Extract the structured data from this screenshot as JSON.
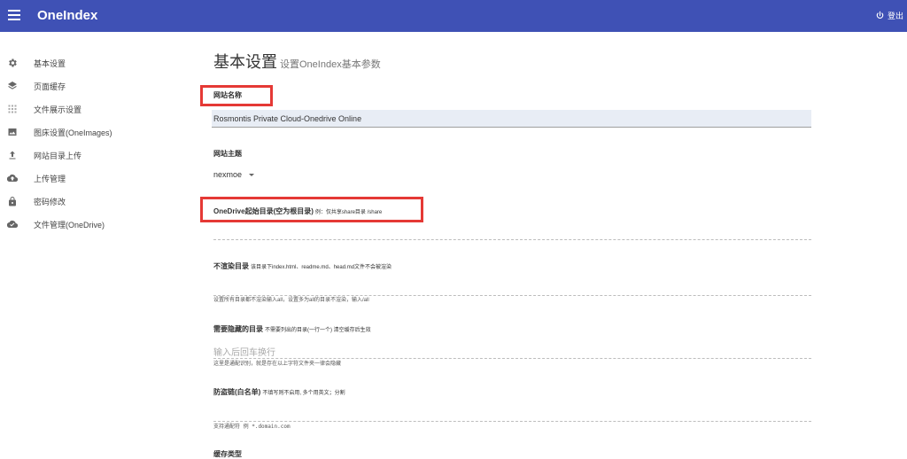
{
  "app": {
    "title": "OneIndex",
    "logout_label": "登出"
  },
  "sidebar": {
    "items": [
      {
        "label": "基本设置",
        "icon": "gear-icon"
      },
      {
        "label": "页面缓存",
        "icon": "layers-icon"
      },
      {
        "label": "文件展示设置",
        "icon": "grid-icon"
      },
      {
        "label": "图床设置(OneImages)",
        "icon": "image-icon"
      },
      {
        "label": "网站目录上传",
        "icon": "upload-icon"
      },
      {
        "label": "上传管理",
        "icon": "cloud-upload-icon"
      },
      {
        "label": "密码修改",
        "icon": "lock-icon"
      },
      {
        "label": "文件管理(OneDrive)",
        "icon": "cloud-done-icon"
      }
    ]
  },
  "page": {
    "title": "基本设置",
    "subtitle": "设置OneIndex基本参数"
  },
  "form": {
    "site_name": {
      "label": "网站名称",
      "value": "Rosmontis Private Cloud-Onedrive Online"
    },
    "theme": {
      "label": "网站主题",
      "value": "nexmoe"
    },
    "root_dir": {
      "label": "OneDrive起始目录(空为根目录)",
      "note": "例：仅共享share目录 /share",
      "value": ""
    },
    "hide_render": {
      "label": "不渲染目录",
      "note": "该目录下index.html、readme.md、head.md文件不会被渲染",
      "hint": "设置所有目录都不渲染输入all，设置多为all的目录不渲染，输入/all",
      "value": ""
    },
    "hidden_dirs": {
      "label": "需要隐藏的目录",
      "note": "不需要列出的目录(一行一个) 清空缓存后生效",
      "placeholder": "输入后回车换行",
      "hint": "这里是通配识别，就是存在以上字符文件夹一律会隐藏"
    },
    "hotlink": {
      "label": "防盗链(白名单)",
      "note": "不填写则不启用, 多个用英文；分割",
      "hint": "支持通配符 例 *.domain.com",
      "value": ""
    },
    "cache_type": {
      "label": "缓存类型"
    }
  },
  "colors": {
    "appbar": "#3f51b5",
    "highlight": "#e53935",
    "input_bg": "#e8edf5"
  }
}
